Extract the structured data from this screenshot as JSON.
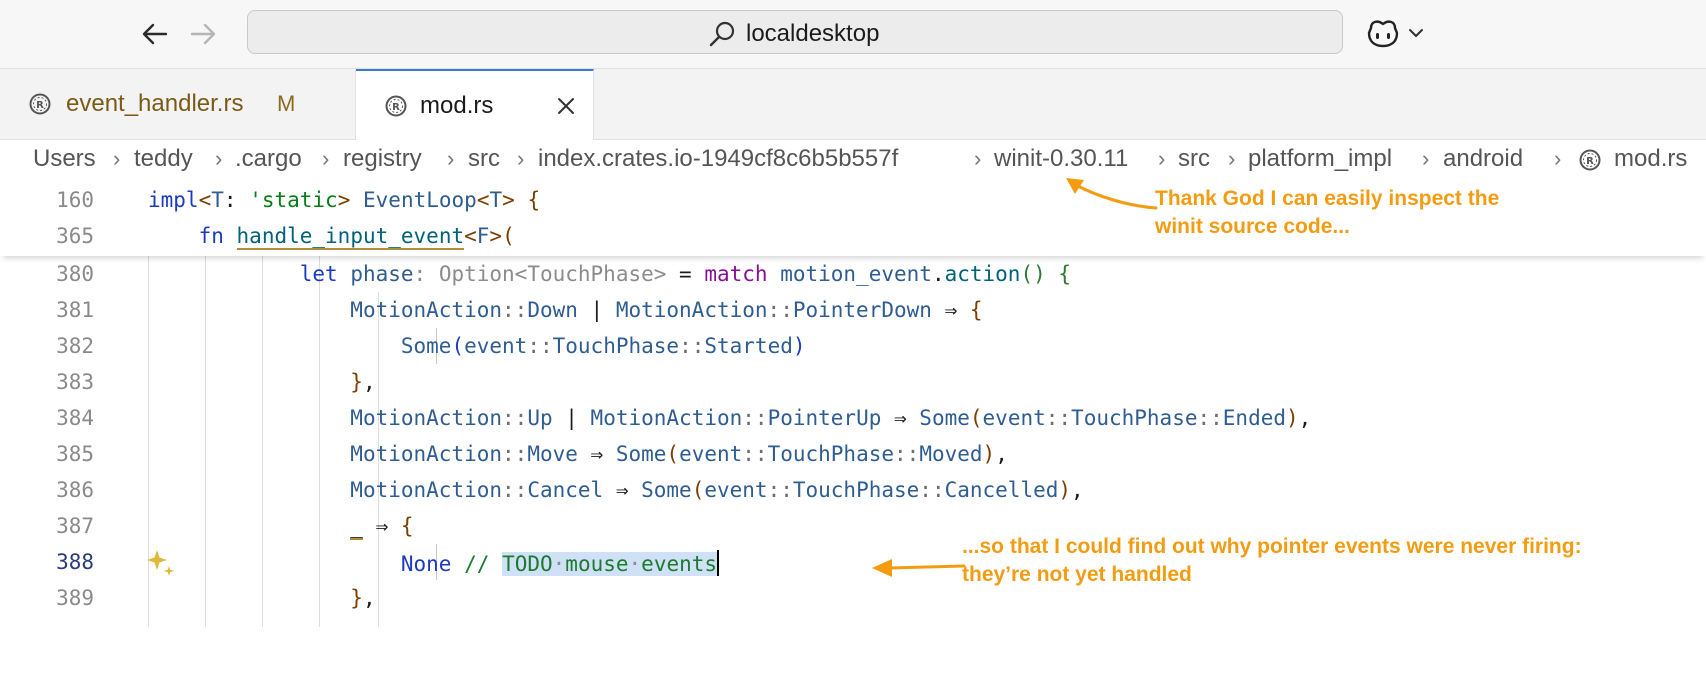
{
  "address_bar": {
    "text": "localdesktop"
  },
  "tabs": [
    {
      "label": "event_handler.rs",
      "status": "M"
    },
    {
      "label": "mod.rs"
    }
  ],
  "breadcrumb": [
    "Users",
    "teddy",
    ".cargo",
    "registry",
    "src",
    "index.crates.io-1949cf8c6b5b557f",
    "winit-0.30.11",
    "src",
    "platform_impl",
    "android",
    "mod.rs"
  ],
  "sticky_lines": [
    {
      "num": "160",
      "code": "impl<T: 'static> EventLoop<T> {"
    },
    {
      "num": "365",
      "code": "fn handle_input_event<F>("
    }
  ],
  "lines": [
    {
      "num": "380",
      "code": "let phase: Option<TouchPhase> = match motion_event.action() {"
    },
    {
      "num": "381",
      "code": "MotionAction::Down | MotionAction::PointerDown => {"
    },
    {
      "num": "382",
      "code": "Some(event::TouchPhase::Started)"
    },
    {
      "num": "383",
      "code": "},"
    },
    {
      "num": "384",
      "code": "MotionAction::Up | MotionAction::PointerUp => Some(event::TouchPhase::Ended),"
    },
    {
      "num": "385",
      "code": "MotionAction::Move => Some(event::TouchPhase::Moved),"
    },
    {
      "num": "386",
      "code": "MotionAction::Cancel => Some(event::TouchPhase::Cancelled),"
    },
    {
      "num": "387",
      "code": "_ => {"
    },
    {
      "num": "388",
      "code": "None // TODO mouse events"
    },
    {
      "num": "389",
      "code": "},"
    }
  ],
  "current_line": "388",
  "annotations": {
    "top": [
      "Thank God I can easily inspect the",
      "winit source code..."
    ],
    "bottom": [
      "...so that I could find out why pointer events were never firing:",
      "they’re not yet handled"
    ]
  },
  "colors": {
    "annotation": "#f39c12",
    "active_tab_border": "#3c7bd0",
    "selection": "#cfe1f7"
  },
  "icons": [
    "back-arrow-icon",
    "forward-arrow-icon",
    "search-icon",
    "copilot-icon",
    "chevron-down-icon",
    "rust-file-icon",
    "close-icon",
    "sparkle-icon"
  ]
}
